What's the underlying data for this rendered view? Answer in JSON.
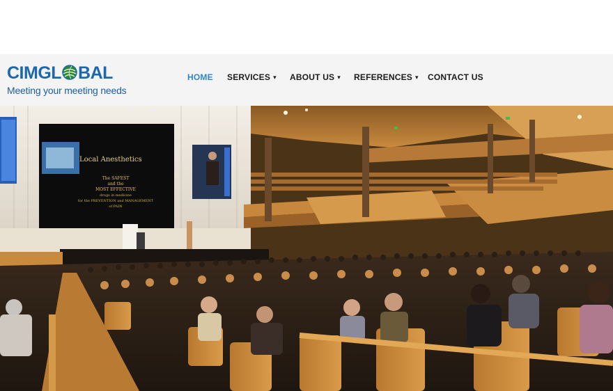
{
  "logo": {
    "part1": "CIM",
    "part2": "GL",
    "part3": "BAL",
    "tagline": "Meeting your meeting needs",
    "icon": "globe-icon"
  },
  "nav": {
    "items": [
      {
        "label": "HOME",
        "dropdown": false,
        "active": true
      },
      {
        "label": "SERVICES",
        "dropdown": true,
        "active": false
      },
      {
        "label": "ABOUT US",
        "dropdown": true,
        "active": false
      },
      {
        "label": "REFERENCES",
        "dropdown": true,
        "active": false
      },
      {
        "label": "CONTACT US",
        "dropdown": false,
        "active": false
      }
    ],
    "caret_icon": "caret-down-icon"
  },
  "hero": {
    "screen": {
      "title": "Local Anesthetics",
      "line1": "The SAFEST",
      "line2": "and the",
      "line3": "MOST EFFECTIVE",
      "line4": "drugs in medicine",
      "line5": "for the PREVENTION and MANAGEMENT",
      "line6": "of PAIN"
    }
  },
  "colors": {
    "brand_blue": "#1c67ad",
    "brand_green": "#2c8a2e",
    "nav_active": "#2e87c9",
    "nav_text": "#1b1b1b",
    "header_bg": "#f4f4f4"
  }
}
